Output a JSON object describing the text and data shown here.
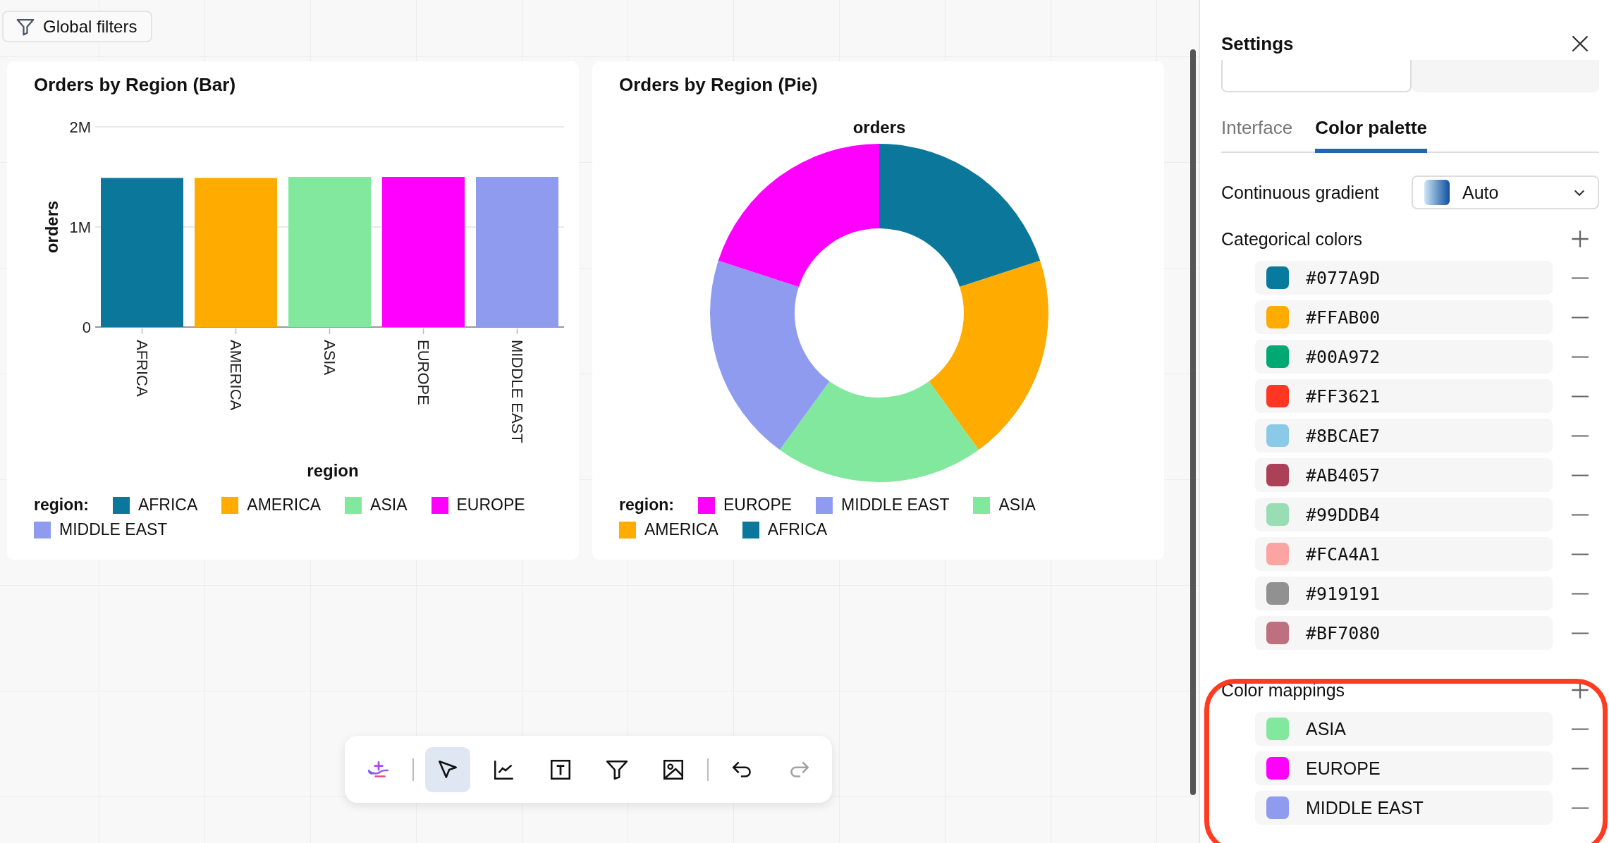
{
  "canvas": {
    "filter_button": {
      "label": "Global filters"
    },
    "bar_card": {
      "title": "Orders by Region (Bar)",
      "chart_data": {
        "type": "bar",
        "xlabel": "region",
        "ylabel": "orders",
        "categories": [
          "AFRICA",
          "AMERICA",
          "ASIA",
          "EUROPE",
          "MIDDLE EAST"
        ],
        "values": [
          1490000,
          1490000,
          1500000,
          1500000,
          1500000
        ],
        "ylim": [
          0,
          2000000
        ],
        "yticks": [
          {
            "value": 0,
            "label": "0"
          },
          {
            "value": 1000000,
            "label": "1M"
          },
          {
            "value": 2000000,
            "label": "2M"
          }
        ]
      },
      "legend": {
        "title": "region:",
        "items": [
          {
            "label": "AFRICA",
            "color": "#0b789b"
          },
          {
            "label": "AMERICA",
            "color": "#ffab00"
          },
          {
            "label": "ASIA",
            "color": "#82e89e"
          },
          {
            "label": "EUROPE",
            "color": "#ff00ff"
          },
          {
            "label": "MIDDLE EAST",
            "color": "#8f9bef"
          }
        ]
      }
    },
    "pie_card": {
      "title": "Orders by Region (Pie)",
      "donut": {
        "title": "orders",
        "slices": [
          {
            "color": "#0b789b"
          },
          {
            "color": "#ffab00"
          },
          {
            "color": "#82e89e"
          },
          {
            "color": "#8f9bef"
          },
          {
            "color": "#ff00ff"
          }
        ]
      },
      "legend": {
        "title": "region:",
        "items": [
          {
            "label": "EUROPE",
            "color": "#ff00ff"
          },
          {
            "label": "MIDDLE EAST",
            "color": "#8f9bef"
          },
          {
            "label": "ASIA",
            "color": "#82e89e"
          },
          {
            "label": "AMERICA",
            "color": "#ffab00"
          },
          {
            "label": "AFRICA",
            "color": "#0b789b"
          }
        ]
      }
    },
    "toolbar": {
      "groups": [
        [
          {
            "kind": "ai",
            "selected": false,
            "disabled": false
          }
        ],
        [
          {
            "kind": "pointer",
            "selected": true,
            "disabled": false
          },
          {
            "kind": "chart",
            "selected": false,
            "disabled": false
          },
          {
            "kind": "text",
            "selected": false,
            "disabled": false
          },
          {
            "kind": "filter",
            "selected": false,
            "disabled": false
          },
          {
            "kind": "image",
            "selected": false,
            "disabled": false
          }
        ],
        [
          {
            "kind": "undo",
            "selected": false,
            "disabled": false
          },
          {
            "kind": "redo",
            "selected": false,
            "disabled": true
          }
        ]
      ]
    }
  },
  "settings": {
    "title": "Settings",
    "theme_buttons": [
      {
        "selected": true
      },
      {
        "selected": false
      }
    ],
    "tabs": [
      {
        "label": "Interface",
        "selected": false
      },
      {
        "label": "Color palette",
        "selected": true
      }
    ],
    "gradient": {
      "label": "Continuous gradient",
      "value": "Auto"
    },
    "categorical": {
      "title": "Categorical colors",
      "colors": [
        {
          "label": "#077A9D",
          "color": "#077a9d"
        },
        {
          "label": "#FFAB00",
          "color": "#ffab00"
        },
        {
          "label": "#00A972",
          "color": "#00a972"
        },
        {
          "label": "#FF3621",
          "color": "#ff3621"
        },
        {
          "label": "#8BCAE7",
          "color": "#8bcae7"
        },
        {
          "label": "#AB4057",
          "color": "#ab4057"
        },
        {
          "label": "#99DDB4",
          "color": "#99ddb4"
        },
        {
          "label": "#FCA4A1",
          "color": "#fca4a1"
        },
        {
          "label": "#919191",
          "color": "#919191"
        },
        {
          "label": "#BF7080",
          "color": "#bf7080"
        }
      ]
    },
    "mappings": {
      "title": "Color mappings",
      "highlighted": true,
      "items": [
        {
          "label": "ASIA",
          "color": "#82e89e"
        },
        {
          "label": "EUROPE",
          "color": "#ff00ff"
        },
        {
          "label": "MIDDLE EAST",
          "color": "#8f9bef"
        }
      ]
    }
  }
}
